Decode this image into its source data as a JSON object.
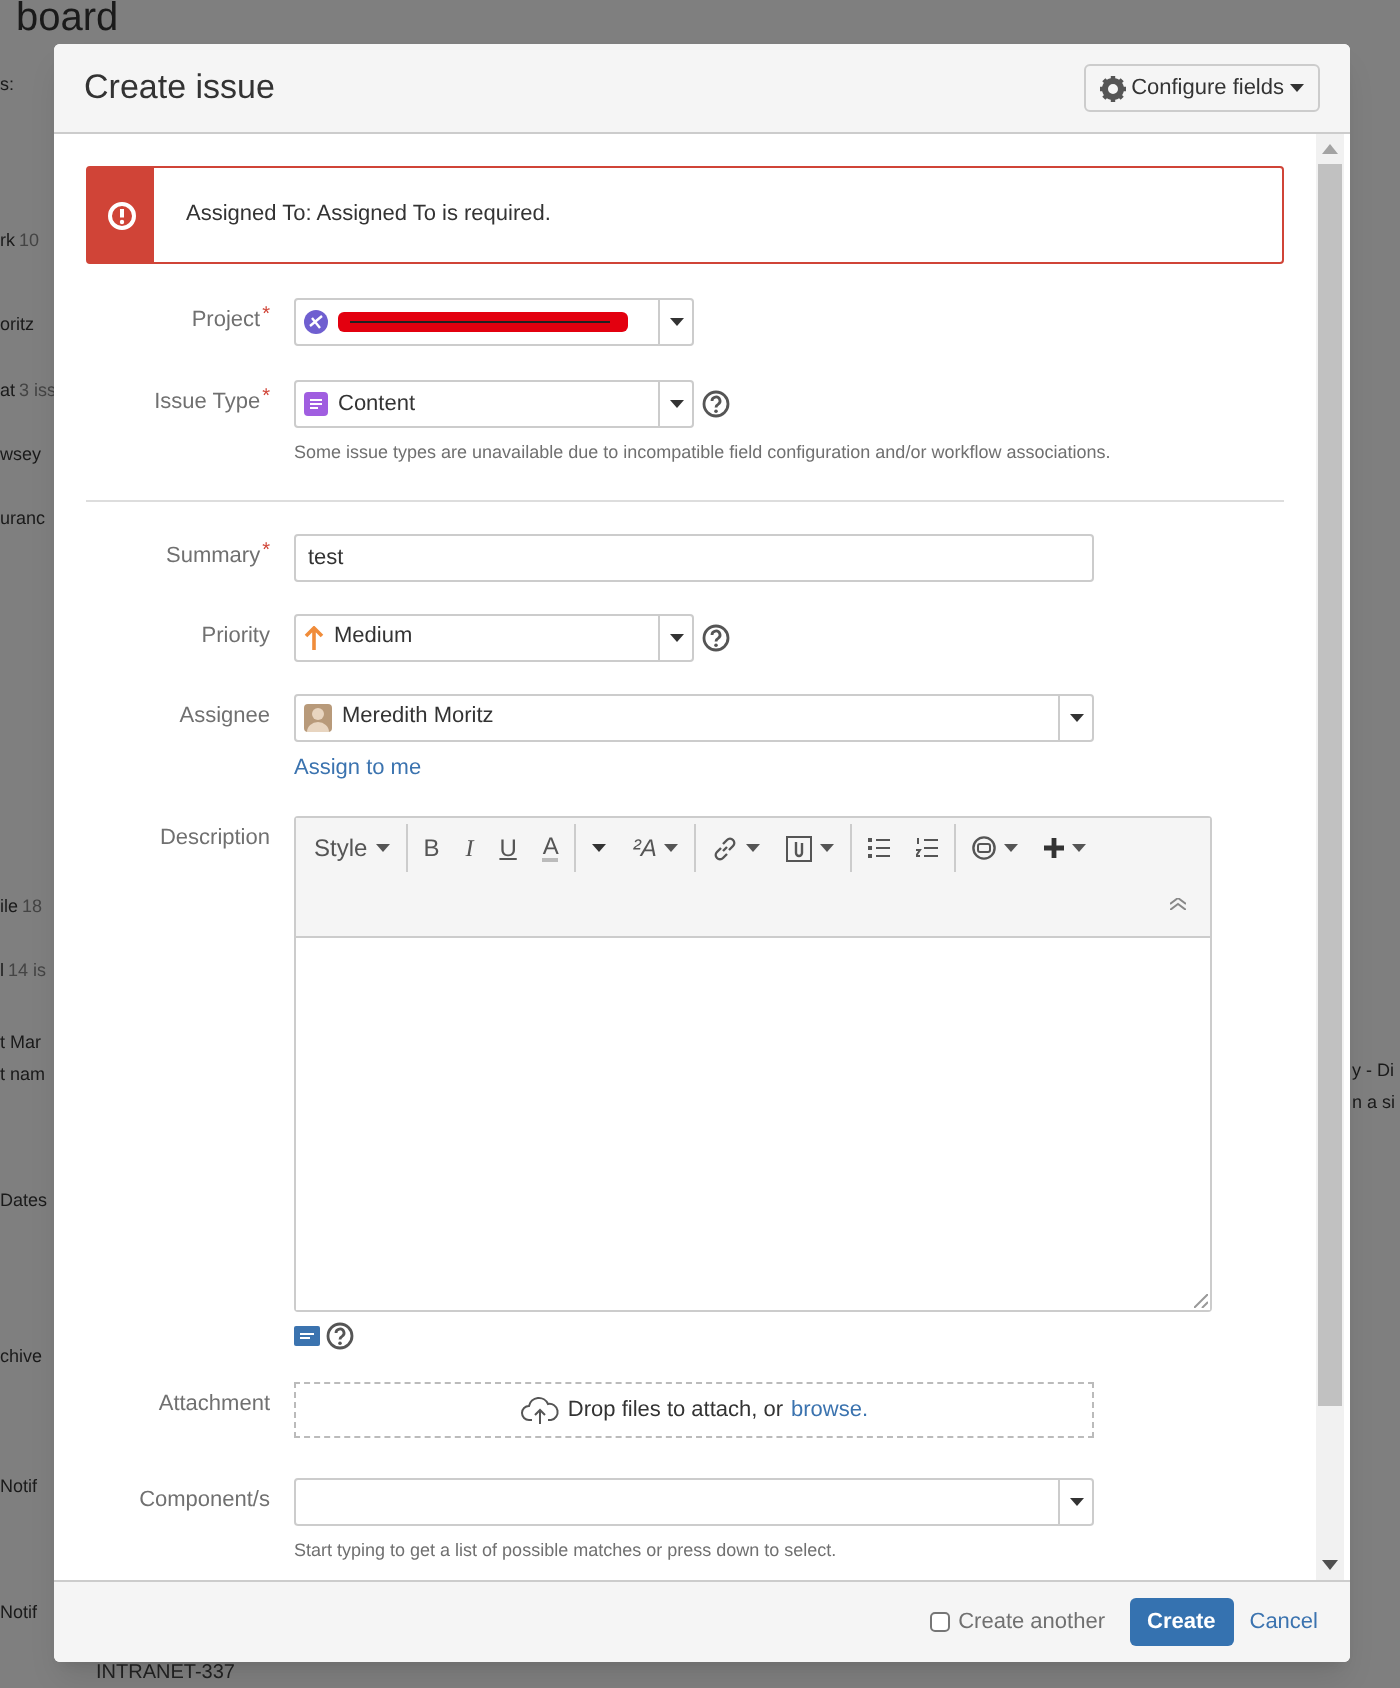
{
  "background": {
    "title": "board",
    "left_texts": [
      {
        "text": "s:"
      },
      {
        "text": "rk",
        "muted": "10"
      },
      {
        "text": "oritz"
      },
      {
        "text": "at",
        "muted": "3 iss"
      },
      {
        "text": "wsey"
      },
      {
        "text": "uranc"
      },
      {
        "text": "ile",
        "muted": "18"
      },
      {
        "text": "l",
        "muted": "14 is"
      },
      {
        "text": "t Mar"
      },
      {
        "text": "t nam"
      },
      {
        "text": "Dates"
      },
      {
        "text": "chive"
      },
      {
        "text": "Notif"
      },
      {
        "text": "Notif"
      }
    ],
    "right_texts": [
      "y - Di",
      "n a si"
    ],
    "bottom_text": "INTRANET-337"
  },
  "dialog": {
    "title": "Create issue",
    "configure_button": "Configure fields",
    "error": "Assigned To: Assigned To is required.",
    "fields": [
      {
        "kind": "project",
        "label": "Project",
        "required_mark": "*"
      },
      {
        "kind": "issue-type",
        "label": "Issue Type",
        "required_mark": "*",
        "value": "Content",
        "hint": "Some issue types are unavailable due to incompatible field configuration and/or workflow associations."
      },
      {
        "kind": "text",
        "label": "Summary",
        "required_mark": "*",
        "value": "test"
      },
      {
        "kind": "priority",
        "label": "Priority",
        "value": "Medium"
      },
      {
        "kind": "user",
        "label": "Assignee",
        "value": "Meredith Moritz",
        "link": "Assign to me"
      },
      {
        "kind": "editor",
        "label": "Description",
        "toolbar": [
          [
            {
              "kind": "style",
              "text": "Style",
              "dropdown": true
            }
          ],
          [
            {
              "kind": "bold",
              "text": "B",
              "dropdown": false
            },
            {
              "kind": "italic",
              "text": "I",
              "dropdown": false
            },
            {
              "kind": "underline",
              "text": "U",
              "dropdown": false
            },
            {
              "kind": "text-color",
              "text": "A",
              "dropdown": false
            }
          ],
          [
            {
              "kind": "caret",
              "dropdown": true
            },
            {
              "kind": "font-size",
              "text": "²A",
              "dropdown": true
            }
          ],
          [
            {
              "kind": "link",
              "dropdown": true
            },
            {
              "kind": "attachment",
              "dropdown": true
            }
          ],
          [
            {
              "kind": "bullet-list",
              "dropdown": false
            },
            {
              "kind": "numbered-list",
              "dropdown": false
            }
          ],
          [
            {
              "kind": "emoji",
              "dropdown": true
            },
            {
              "kind": "plus",
              "dropdown": true
            }
          ]
        ]
      },
      {
        "kind": "attachment",
        "label": "Attachment",
        "text": "Drop files to attach, or",
        "link": "browse."
      },
      {
        "kind": "multi-select",
        "label": "Component/s",
        "hint": "Start typing to get a list of possible matches or press down to select."
      }
    ],
    "footer": {
      "create_another": {
        "label": "Create another",
        "checked": false
      },
      "create_button": "Create",
      "cancel": "Cancel"
    }
  }
}
